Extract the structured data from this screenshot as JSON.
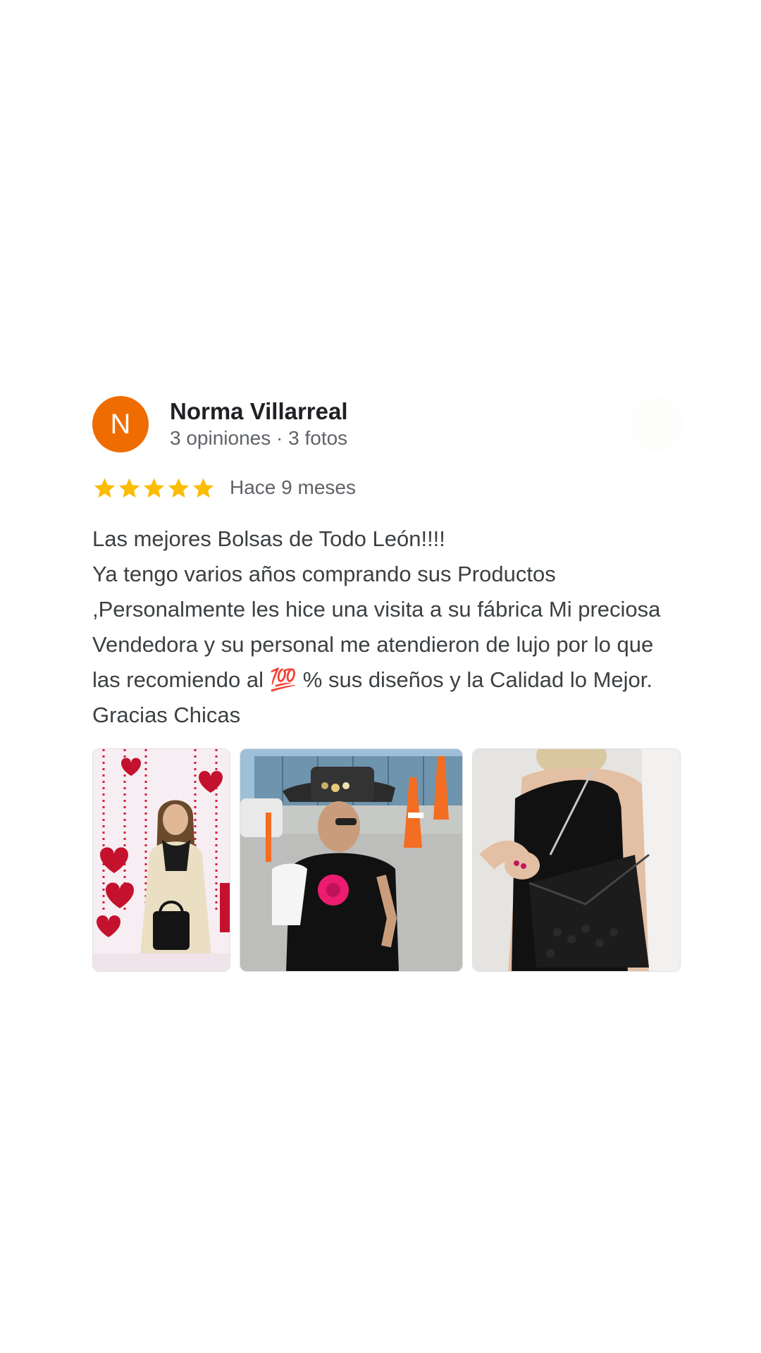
{
  "review": {
    "avatar_letter": "N",
    "author_name": "Norma Villarreal",
    "author_meta": "3 opiniones · 3 fotos",
    "rating": 5,
    "rating_max": 5,
    "date": "Hace 9 meses",
    "text_line1": "Las mejores Bolsas de Todo León!!!!",
    "text_body": "Ya tengo varios años comprando sus Productos ,Personalmente les hice una visita a su fábrica Mi preciosa Vendedora y su personal me atendieron de lujo por lo que las recomiendo al 💯 % sus diseños y la Calidad lo Mejor. Gracias Chicas",
    "photos": [
      {
        "icon": "photo-woman-valentine-backdrop"
      },
      {
        "icon": "photo-woman-hat-street"
      },
      {
        "icon": "photo-woman-black-handbag"
      }
    ]
  },
  "colors": {
    "avatar_bg": "#ef6c00",
    "star": "#fbbc04",
    "name": "#202124",
    "meta": "#5f6368",
    "text": "#3c4043"
  }
}
